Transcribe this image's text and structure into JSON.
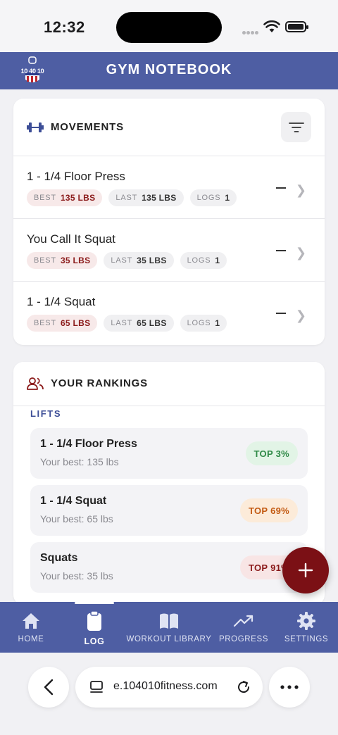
{
  "status_bar": {
    "time": "12:32"
  },
  "header": {
    "logo_text": "10 40 10",
    "title": "GYM NOTEBOOK"
  },
  "movements": {
    "title": "MOVEMENTS",
    "items": [
      {
        "name": "1 - 1/4 Floor Press",
        "best_label": "BEST",
        "best": "135 LBS",
        "last_label": "LAST",
        "last": "135 LBS",
        "logs_label": "LOGS",
        "logs": "1"
      },
      {
        "name": "You Call It Squat",
        "best_label": "BEST",
        "best": "35 LBS",
        "last_label": "LAST",
        "last": "35 LBS",
        "logs_label": "LOGS",
        "logs": "1"
      },
      {
        "name": "1 - 1/4 Squat",
        "best_label": "BEST",
        "best": "65 LBS",
        "last_label": "LAST",
        "last": "65 LBS",
        "logs_label": "LOGS",
        "logs": "1"
      }
    ]
  },
  "rankings": {
    "title": "YOUR RANKINGS",
    "section_label": "LIFTS",
    "items": [
      {
        "name": "1 - 1/4 Floor Press",
        "sub": "Your best: 135 lbs",
        "badge": "TOP 3%"
      },
      {
        "name": "1 - 1/4 Squat",
        "sub": "Your best: 65 lbs",
        "badge": "TOP 69%"
      },
      {
        "name": "Squats",
        "sub": "Your best: 35 lbs",
        "badge": "TOP 91%"
      }
    ]
  },
  "bottom_nav": {
    "items": [
      {
        "label": "HOME",
        "icon": "home-icon"
      },
      {
        "label": "LOG",
        "icon": "clipboard-icon"
      },
      {
        "label": "WORKOUT LIBRARY",
        "icon": "book-icon"
      },
      {
        "label": "PROGRESS",
        "icon": "trend-icon"
      },
      {
        "label": "SETTINGS",
        "icon": "gear-icon"
      }
    ]
  },
  "browser": {
    "url": "e.104010fitness.com"
  },
  "colors": {
    "brand": "#4e5ea3",
    "accent": "#7b1015",
    "badge_green": "#2f8a47",
    "badge_orange": "#c35a12"
  }
}
